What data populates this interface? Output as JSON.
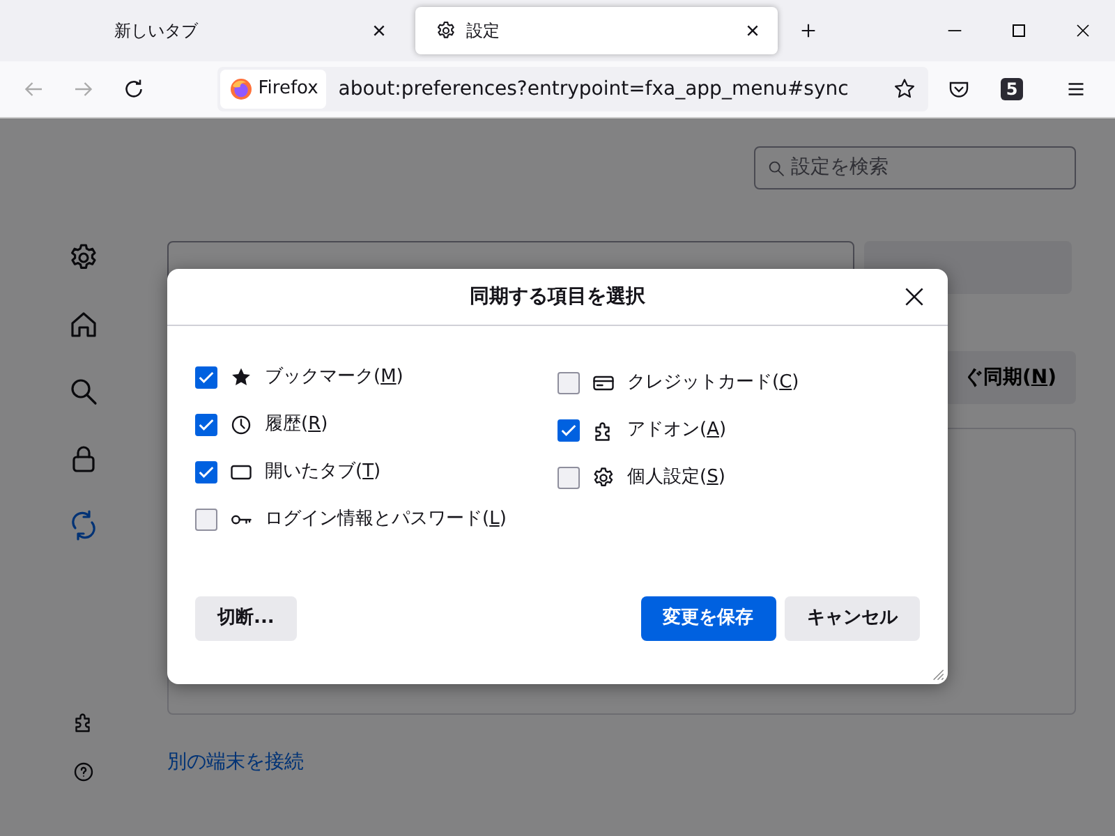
{
  "tabs": [
    {
      "label": "新しいタブ",
      "kind": "blank",
      "selected": false
    },
    {
      "label": "設定",
      "kind": "gear",
      "selected": true
    }
  ],
  "toolbar": {
    "identity": "Firefox",
    "url": "about:preferences?entrypoint=fxa_app_menu#sync",
    "extension_badge": "5"
  },
  "search": {
    "placeholder": "設定を検索"
  },
  "sidebar": {
    "items": [
      {
        "kind": "gear",
        "selected": false
      },
      {
        "kind": "home",
        "selected": false
      },
      {
        "kind": "search",
        "selected": false
      },
      {
        "kind": "lock",
        "selected": false
      },
      {
        "kind": "sync",
        "selected": true
      }
    ],
    "footer": [
      {
        "kind": "puzzle"
      },
      {
        "kind": "help"
      }
    ]
  },
  "sync_page": {
    "sync_button": "ぐ同期(N)",
    "connect_link": "別の端末を接続"
  },
  "dialog": {
    "title": "同期する項目を選択",
    "columns": [
      [
        {
          "label": "ブックマーク(M)",
          "kind": "star",
          "checked": true
        },
        {
          "label": "履歴(R)",
          "kind": "clock",
          "checked": true
        },
        {
          "label": "開いたタブ(T)",
          "kind": "tab",
          "checked": true
        },
        {
          "label": "ログイン情報とパスワード(L)",
          "kind": "key",
          "checked": false
        }
      ],
      [
        {
          "label": "クレジットカード(C)",
          "kind": "card",
          "checked": false
        },
        {
          "label": "アドオン(A)",
          "kind": "puzzle",
          "checked": true
        },
        {
          "label": "個人設定(S)",
          "kind": "gear",
          "checked": false
        }
      ]
    ],
    "disconnect_button": "切断...",
    "save_button": "変更を保存",
    "cancel_button": "キャンセル"
  }
}
